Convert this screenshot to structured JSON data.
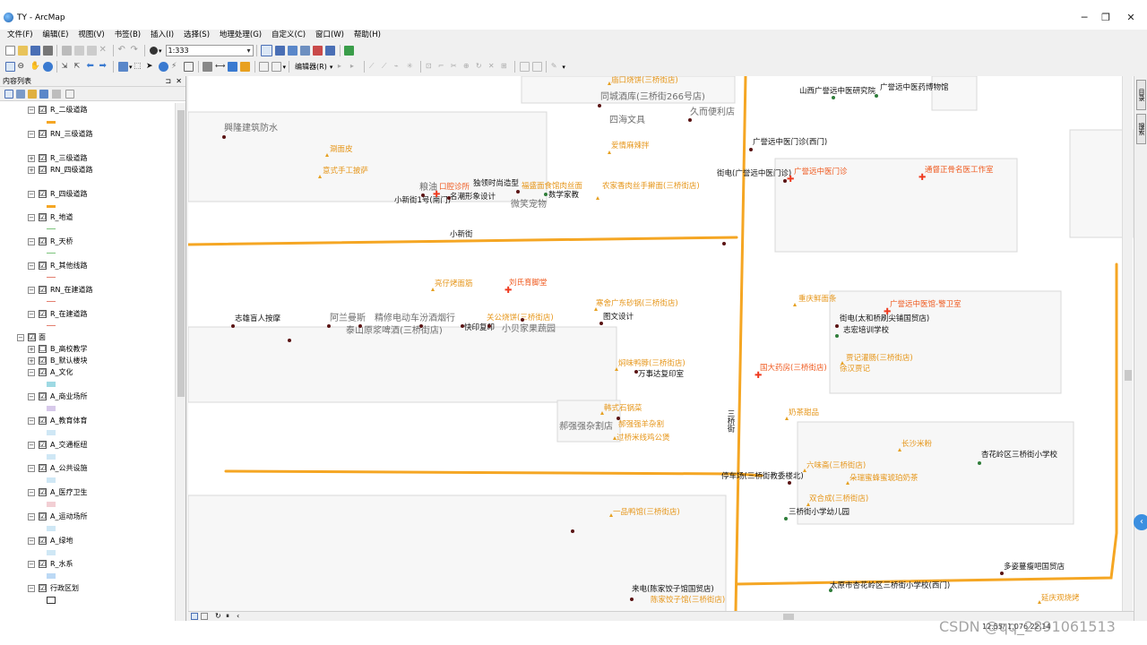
{
  "window": {
    "title": "TY - ArcMap"
  },
  "menu": [
    "文件(F)",
    "编辑(E)",
    "视图(V)",
    "书签(B)",
    "插入(I)",
    "选择(S)",
    "地理处理(G)",
    "自定义(C)",
    "窗口(W)",
    "帮助(H)"
  ],
  "toolbar": {
    "scale": "1:333",
    "editor_label": "编辑器(R)"
  },
  "toc": {
    "title": "内容列表",
    "layers": [
      {
        "label": "R_二级道路",
        "checked": "☑",
        "swatch": "#f5a623"
      },
      {
        "label": "RN_三级道路",
        "checked": "☑",
        "swatch": "#ffffff"
      },
      {
        "label": "R_三级道路",
        "checked": "☑",
        "swatch": ""
      },
      {
        "label": "RN_四级道路",
        "checked": "☑",
        "swatch": ""
      },
      {
        "label": "R_四级道路",
        "checked": "☑",
        "swatch": "#f5a623"
      },
      {
        "label": "R_地道",
        "checked": "☑",
        "swatch": "#7cc47c"
      },
      {
        "label": "R_天桥",
        "checked": "☑",
        "swatch": "#7cc47c"
      },
      {
        "label": "R_其他线路",
        "checked": "☑",
        "swatch": "#e37f6f"
      },
      {
        "label": "RN_在建道路",
        "checked": "☑",
        "swatch": "#e37f6f"
      },
      {
        "label": "R_在建道路",
        "checked": "☑",
        "swatch": "#e37f6f"
      },
      {
        "label": "面",
        "checked": "☑",
        "swatch": ""
      },
      {
        "label": "B_高校教学",
        "checked": "☐",
        "swatch": ""
      },
      {
        "label": "B_默认楼块",
        "checked": "☑",
        "swatch": ""
      },
      {
        "label": "A_文化",
        "checked": "☑",
        "swatch": "#9ed9e3"
      },
      {
        "label": "A_商业场所",
        "checked": "☑",
        "swatch": "#d7c9ea"
      },
      {
        "label": "A_教育体育",
        "checked": "☑",
        "swatch": "#cfe7f5"
      },
      {
        "label": "A_交通枢纽",
        "checked": "☑",
        "swatch": "#cfe7f5"
      },
      {
        "label": "A_公共设施",
        "checked": "☑",
        "swatch": "#cfe7f5"
      },
      {
        "label": "A_医疗卫生",
        "checked": "☑",
        "swatch": "#f2cfd4"
      },
      {
        "label": "A_运动场所",
        "checked": "☑",
        "swatch": "#cfe7f5"
      },
      {
        "label": "A_绿地",
        "checked": "☑",
        "swatch": "#cfe7f5"
      },
      {
        "label": "R_水系",
        "checked": "☑",
        "swatch": "#bcd9f5"
      },
      {
        "label": "行政区划",
        "checked": "☑",
        "swatch": "#ffffff"
      }
    ]
  },
  "map": {
    "roads": {
      "xinjie": "小新街",
      "sanqiao": "三桥街"
    },
    "labels_gray": [
      "興隆建筑防水",
      "同城酒库(三桥街266号店)",
      "四海文具",
      "久而便利店",
      "粮油",
      "微笑宠物",
      "阿兰曼斯",
      "精修电动车汾酒烟行",
      "泰山原浆啤酒(三桥街店)",
      "小贝家果蔬园",
      "郝强强杂割店"
    ],
    "labels_black": [
      "山西广誉远中医研究院",
      "广誉远中医药博物馆",
      "广誉远中医门诊(西门)",
      "街电(广誉远中医门诊)",
      "独领时尚造型",
      "数学家教",
      "小新街1号(南门)",
      "名潮形象设计",
      "志雄盲人按摩",
      "快印复印",
      "图文设计",
      "街电(太和桥刷尖铺国贸店)",
      "志宏培训学校",
      "万事达复印室",
      "停车场(三桥街教委楼北)",
      "杏花岭区三桥街小学校",
      "三桥街小学幼儿园",
      "太原市杏花岭区三桥街小学校(西门)",
      "多姿蔓瘦吧国贸店",
      "来电(陈家饺子馆国贸店)"
    ],
    "labels_orange": [
      "庙口烧饼(三桥街店)",
      "爱情麻辣拌",
      "涮面皮",
      "意式手工披萨",
      "福盛面食馆肉丝面",
      "农家香肉丝手擀面(三桥街店)",
      "亮仔烤面筋",
      "关公烧饼(三桥街店)",
      "寒舍广东砂锅(三桥街店)",
      "重庆鲜面条",
      "焖味鸭脖(三桥街店)",
      "贾记灌肠(三桥街店)",
      "徐汉贾记",
      "韩式石锅菜",
      "郝强强羊杂割",
      "过桥米线鸡公煲",
      "奶茶甜品",
      "长沙米粉",
      "六味斋(三桥街店)",
      "朵瑞蜜蜂蜜琥珀奶茶",
      "双合成(三桥街店)",
      "一品鸭馆(三桥街店)",
      "陈家饺子馆(三桥街店)",
      "延庆观烧烤"
    ],
    "labels_red": [
      "口腔诊所",
      "刘氏育脚堂",
      "广誉远中医门诊",
      "通督正骨名医工作室",
      "广誉远中医馆-警卫室",
      "国大药房(三桥街店)"
    ]
  },
  "status": {
    "coords": "12.55/  1,076  22.14"
  },
  "watermark": "CSDN @qq_2891061513"
}
